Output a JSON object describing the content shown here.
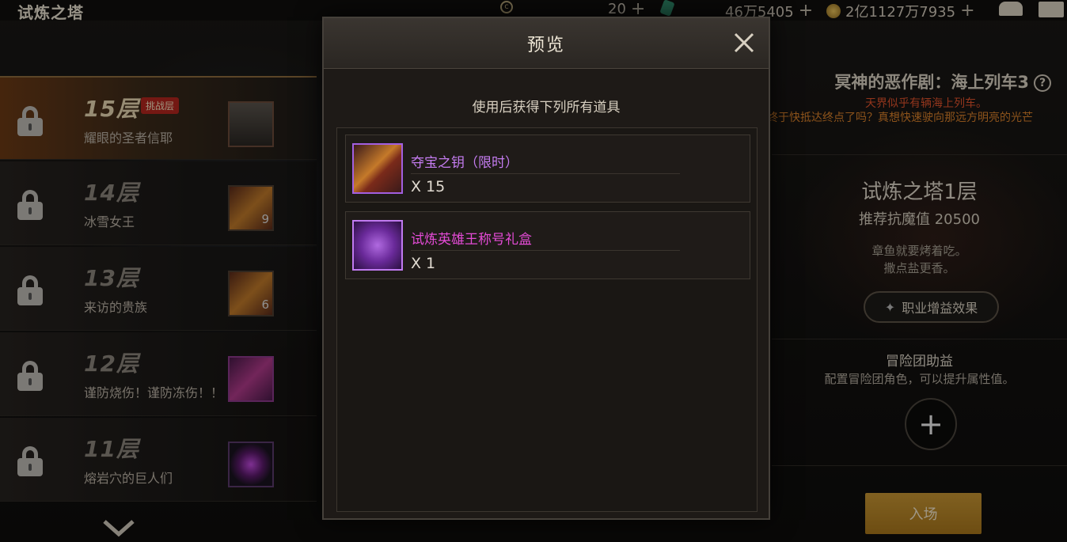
{
  "topbar": {
    "title": "试炼之塔",
    "resource1": "20",
    "resource2": "46万5405",
    "resource3": "2亿1127万7935"
  },
  "floors": [
    {
      "num": "15层",
      "name": "耀眼的圣者信耶",
      "tag": "挑战层",
      "count": ""
    },
    {
      "num": "14层",
      "name": "冰雪女王",
      "tag": "",
      "count": "9"
    },
    {
      "num": "13层",
      "name": "来访的贵族",
      "tag": "",
      "count": "6"
    },
    {
      "num": "12层",
      "name": "谨防烧伤！谨防冻伤！！",
      "tag": "",
      "count": ""
    },
    {
      "num": "11层",
      "name": "熔岩穴的巨人们",
      "tag": "",
      "count": ""
    }
  ],
  "right": {
    "event_title": "冥神的恶作剧：海上列车3",
    "event_sub1": "天界似乎有辆海上列车。",
    "event_sub2": "终于快抵达终点了吗？真想快速驶向那远方明亮的光芒",
    "tower_title": "试炼之塔1层",
    "tower_rec": "推荐抗魔值 20500",
    "tower_desc1": "章鱼就要烤着吃。",
    "tower_desc2": "撒点盐更香。",
    "buff_label": "职业增益效果",
    "support_title": "冒险团助益",
    "support_desc": "配置冒险团角色，可以提升属性值。",
    "enter_label": "入场"
  },
  "modal": {
    "title": "预览",
    "subtitle": "使用后获得下列所有道具",
    "rewards": [
      {
        "name": "夺宝之钥（限时）",
        "qty": "X 15"
      },
      {
        "name": "试炼英雄王称号礼盒",
        "qty": "X 1"
      }
    ]
  },
  "colors": {
    "accent_gold": "#c69533",
    "rare_purple": "#c47cf0",
    "epic_pink": "#e44bd6",
    "challenge_red": "#b3261e"
  }
}
